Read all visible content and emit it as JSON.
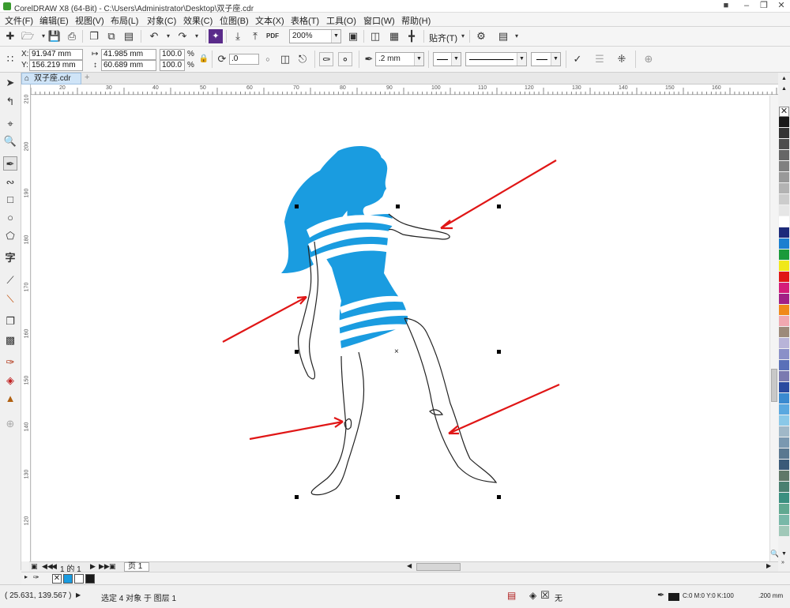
{
  "window": {
    "title": "CorelDRAW X8 (64-Bit) - C:\\Users\\Administrator\\Desktop\\双子座.cdr",
    "restore": "❐",
    "close": "✕"
  },
  "menu": [
    "文件(F)",
    "编辑(E)",
    "视图(V)",
    "布局(L)",
    "对象(C)",
    "效果(C)",
    "位图(B)",
    "文本(X)",
    "表格(T)",
    "工具(O)",
    "窗口(W)",
    "帮助(H)"
  ],
  "toolbar": {
    "zoom": "200%",
    "pdf_label": "PDF",
    "snap_label": "贴齐(T)"
  },
  "properties": {
    "x_label": "X:",
    "x_value": "91.947 mm",
    "y_label": "Y:",
    "y_value": "156.219 mm",
    "width": "41.985 mm",
    "height": "60.689 mm",
    "scale_x": "100.0",
    "scale_y": "100.0",
    "percent": "%",
    "angle": ".0",
    "outline_width": ".2 mm"
  },
  "document_tab": {
    "name": "双子座.cdr",
    "add": "+"
  },
  "ruler": {
    "h_ticks": [
      "20",
      "30",
      "40",
      "50",
      "60",
      "70",
      "80",
      "90",
      "100",
      "110",
      "120",
      "130",
      "140",
      "150",
      "160"
    ],
    "v_ticks": [
      "210",
      "200",
      "190",
      "180",
      "170",
      "160",
      "150",
      "140",
      "130",
      "120"
    ]
  },
  "page_nav": {
    "counter": "1 的 1",
    "page_tab": "页 1"
  },
  "status": {
    "coords": "( 25.631, 139.567 )",
    "selection": "选定 4 对象 于 图层 1",
    "fill_none": "无",
    "color_info": "C:0 M:0 Y:0 K:100",
    "outline": ".200 mm"
  },
  "colors": {
    "figure_blue": "#1a9ce0",
    "arrow_red": "#e01616",
    "palette": [
      "#1a1a1a",
      "#333333",
      "#4d4d4d",
      "#666666",
      "#808080",
      "#999999",
      "#b3b3b3",
      "#cccccc",
      "#e6e6e6",
      "#ffffff",
      "#1c2a7a",
      "#1a7fd0",
      "#1a9a3a",
      "#f0e81a",
      "#e01616",
      "#d41c7a",
      "#a12086",
      "#f08a1a",
      "#f0a8b0",
      "#9c8a7a",
      "#b8b4d8",
      "#8a90c8",
      "#5a70b8",
      "#7a7ab0",
      "#2a4aa0",
      "#3a8ad0",
      "#5aa8e0",
      "#8ac8e8",
      "#a0b8c8",
      "#7a98b0",
      "#5a7890",
      "#3a5a78",
      "#607868",
      "#4a8070",
      "#3a9080",
      "#60a890",
      "#78b8a8",
      "#a0c8b8"
    ]
  }
}
